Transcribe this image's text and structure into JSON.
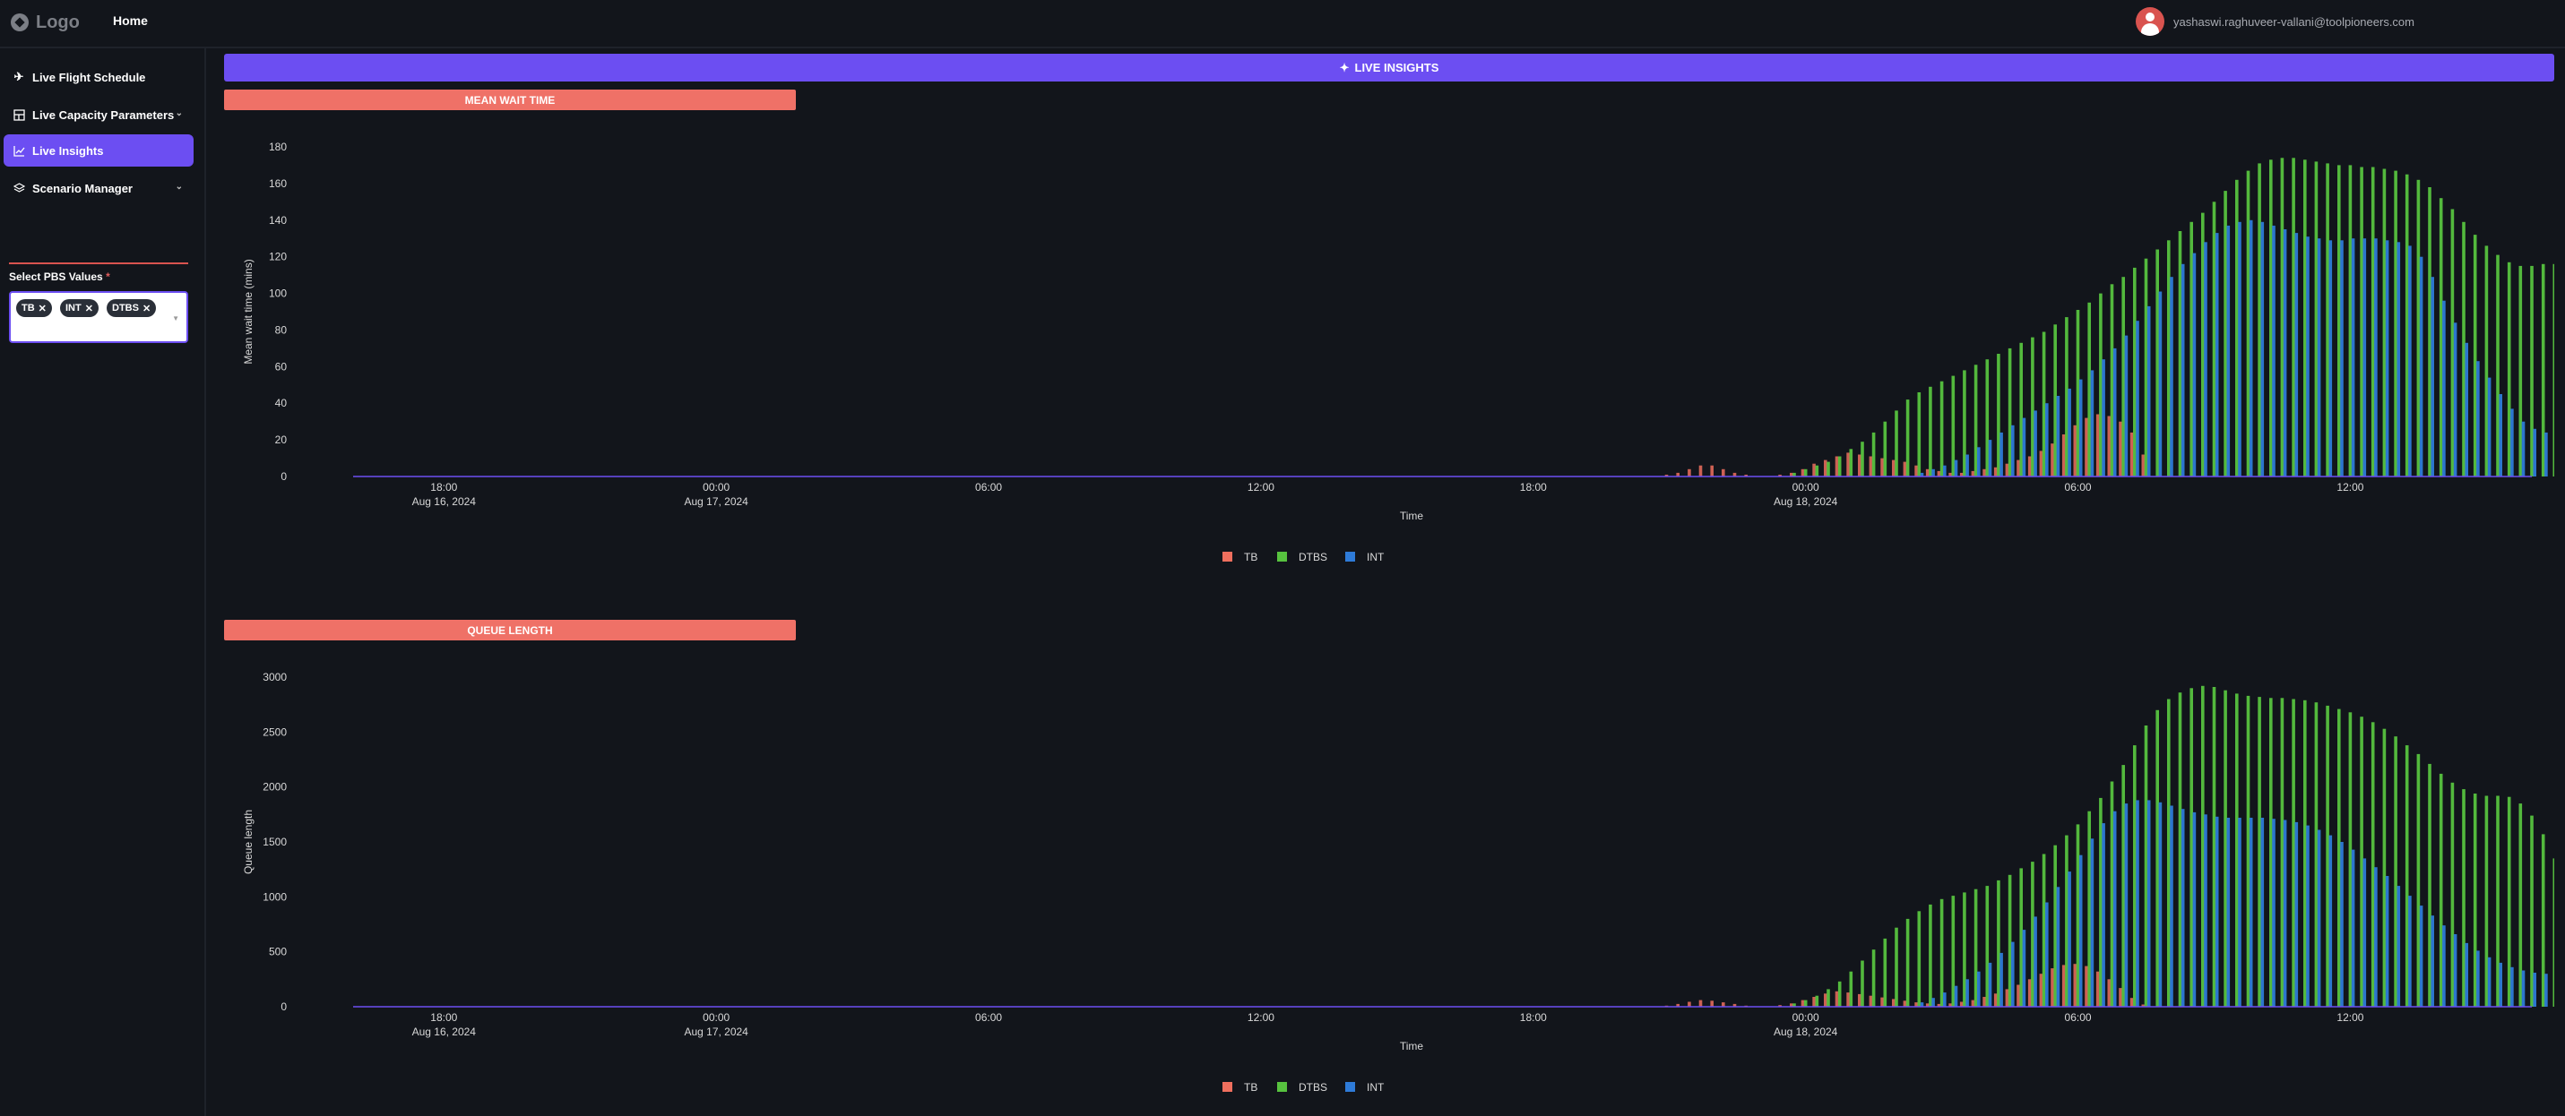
{
  "topbar": {
    "logo_text": "Logo",
    "home_label": "Home",
    "user_email": "yashaswi.raghuveer-vallani@toolpioneers.com"
  },
  "sidebar": {
    "items": [
      {
        "label": "Live Flight Schedule",
        "icon": "plane-icon"
      },
      {
        "label": "Live Capacity Parameters",
        "icon": "dashboard-icon"
      },
      {
        "label": "Live Insights",
        "icon": "chart-line-icon"
      },
      {
        "label": "Scenario Manager",
        "icon": "layers-icon"
      }
    ],
    "pbs": {
      "label": "Select PBS Values",
      "required_mark": "*",
      "selected": [
        "TB",
        "INT",
        "DTBS"
      ]
    }
  },
  "main": {
    "banner_title": "LIVE INSIGHTS",
    "sections": [
      "MEAN WAIT TIME",
      "QUEUE LENGTH"
    ]
  },
  "colors": {
    "TB": "#ef6f5e",
    "DTBS": "#57c23f",
    "INT": "#2e7bd8",
    "accent": "#6c4ef2"
  },
  "chart_data": [
    {
      "type": "bar",
      "xlabel": "Time",
      "ylabel": "Mean wait time (mins)",
      "ylim": [
        0,
        180
      ],
      "yticks": [
        0,
        20,
        40,
        60,
        80,
        100,
        120,
        140,
        160,
        180
      ],
      "xticks": [
        "18:00",
        "00:00",
        "06:00",
        "12:00",
        "18:00",
        "00:00",
        "06:00",
        "12:00"
      ],
      "xtick_dates": [
        "Aug 16, 2024",
        "Aug 17, 2024",
        "",
        "",
        "",
        "Aug 18, 2024",
        "",
        ""
      ],
      "legend": [
        "TB",
        "DTBS",
        "INT"
      ],
      "legend_position": "bottom-center",
      "series": [
        {
          "name": "TB",
          "start": "Aug 17, 2024 21:00",
          "interval_min": 15,
          "values": [
            1,
            2,
            4,
            6,
            6,
            4,
            2,
            1,
            0,
            0,
            1,
            2,
            4,
            7,
            9,
            11,
            13,
            12,
            11,
            10,
            9,
            8,
            6,
            4,
            3,
            2,
            2,
            3,
            4,
            5,
            7,
            9,
            11,
            14,
            18,
            23,
            28,
            32,
            34,
            33,
            30,
            24,
            12
          ]
        },
        {
          "name": "DTBS",
          "start": "Aug 17, 2024 23:45",
          "interval_min": 15,
          "values": [
            2,
            4,
            6,
            8,
            11,
            15,
            19,
            24,
            30,
            36,
            42,
            46,
            49,
            52,
            55,
            58,
            61,
            64,
            67,
            70,
            73,
            76,
            79,
            83,
            87,
            91,
            95,
            100,
            105,
            109,
            114,
            119,
            124,
            129,
            134,
            139,
            144,
            150,
            156,
            162,
            167,
            171,
            173,
            174,
            174,
            173,
            172,
            171,
            170,
            170,
            169,
            169,
            168,
            167,
            165,
            162,
            158,
            152,
            146,
            139,
            132,
            126,
            121,
            117,
            115,
            115,
            116,
            116,
            116,
            116
          ]
        },
        {
          "name": "INT",
          "start": "Aug 18, 2024 02:30",
          "interval_min": 15,
          "values": [
            2,
            4,
            6,
            9,
            12,
            16,
            20,
            24,
            28,
            32,
            36,
            40,
            44,
            48,
            53,
            58,
            64,
            70,
            77,
            85,
            93,
            101,
            109,
            116,
            122,
            128,
            133,
            137,
            139,
            140,
            139,
            137,
            135,
            133,
            131,
            130,
            129,
            129,
            130,
            130,
            130,
            129,
            128,
            126,
            120,
            109,
            96,
            84,
            73,
            63,
            54,
            45,
            37,
            30,
            26,
            24,
            23,
            23,
            23,
            22,
            20,
            15,
            5
          ]
        }
      ]
    },
    {
      "type": "bar",
      "xlabel": "Time",
      "ylabel": "Queue length",
      "ylim": [
        0,
        3000
      ],
      "yticks": [
        0,
        500,
        1000,
        1500,
        2000,
        2500,
        3000
      ],
      "xticks": [
        "18:00",
        "00:00",
        "06:00",
        "12:00",
        "18:00",
        "00:00",
        "06:00",
        "12:00"
      ],
      "xtick_dates": [
        "Aug 16, 2024",
        "Aug 17, 2024",
        "",
        "",
        "",
        "Aug 18, 2024",
        "",
        ""
      ],
      "legend": [
        "TB",
        "DTBS",
        "INT"
      ],
      "legend_position": "bottom-center",
      "series": [
        {
          "name": "TB",
          "start": "Aug 17, 2024 21:00",
          "interval_min": 15,
          "values": [
            10,
            25,
            45,
            60,
            55,
            40,
            25,
            10,
            0,
            0,
            15,
            30,
            60,
            90,
            120,
            140,
            130,
            115,
            100,
            85,
            70,
            55,
            40,
            30,
            25,
            30,
            45,
            60,
            90,
            120,
            160,
            200,
            250,
            300,
            350,
            380,
            390,
            370,
            320,
            250,
            170,
            80,
            20
          ]
        },
        {
          "name": "DTBS",
          "start": "Aug 17, 2024 23:45",
          "interval_min": 15,
          "values": [
            30,
            60,
            100,
            160,
            230,
            320,
            420,
            520,
            620,
            720,
            800,
            870,
            930,
            980,
            1010,
            1040,
            1070,
            1100,
            1150,
            1200,
            1260,
            1320,
            1390,
            1470,
            1560,
            1660,
            1780,
            1900,
            2050,
            2200,
            2380,
            2560,
            2700,
            2800,
            2860,
            2900,
            2920,
            2910,
            2880,
            2850,
            2830,
            2820,
            2810,
            2810,
            2800,
            2790,
            2770,
            2740,
            2710,
            2680,
            2640,
            2590,
            2530,
            2460,
            2380,
            2300,
            2210,
            2120,
            2040,
            1980,
            1940,
            1920,
            1920,
            1910,
            1850,
            1740,
            1570,
            1350,
            1040,
            560
          ]
        },
        {
          "name": "INT",
          "start": "Aug 18, 2024 02:30",
          "interval_min": 15,
          "values": [
            40,
            80,
            130,
            190,
            250,
            320,
            400,
            490,
            590,
            700,
            820,
            950,
            1090,
            1230,
            1380,
            1530,
            1670,
            1780,
            1850,
            1880,
            1880,
            1860,
            1830,
            1800,
            1770,
            1750,
            1730,
            1720,
            1720,
            1720,
            1720,
            1710,
            1700,
            1680,
            1650,
            1610,
            1560,
            1500,
            1430,
            1350,
            1270,
            1190,
            1100,
            1010,
            920,
            830,
            740,
            660,
            580,
            510,
            450,
            400,
            360,
            330,
            310,
            300,
            290,
            290,
            290,
            280,
            250,
            170,
            60
          ]
        }
      ]
    }
  ]
}
